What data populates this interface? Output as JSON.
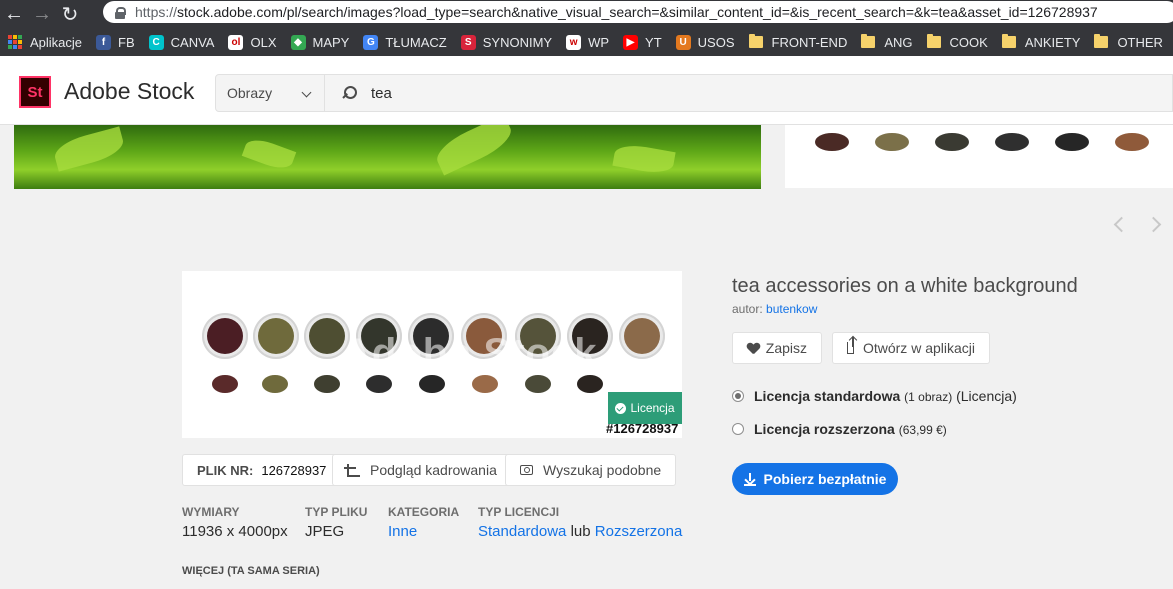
{
  "browser": {
    "url_scheme": "https://",
    "url_rest": "stock.adobe.com/pl/search/images?load_type=search&native_visual_search=&similar_content_id=&is_recent_search=&k=tea&asset_id=126728937",
    "bookmarks": [
      {
        "label": "Aplikacje",
        "icon": "apps-grid-icon"
      },
      {
        "label": "FB",
        "icon": "facebook-icon",
        "color": "#3b5998",
        "glyph": "f"
      },
      {
        "label": "CANVA",
        "icon": "canva-icon",
        "color": "#00c4cc",
        "glyph": "C"
      },
      {
        "label": "OLX",
        "icon": "olx-icon",
        "color": "#ffffff",
        "glyph": "ol"
      },
      {
        "label": "MAPY",
        "icon": "maps-icon",
        "color": "#34a853",
        "glyph": "◆"
      },
      {
        "label": "TŁUMACZ",
        "icon": "translate-icon",
        "color": "#4285f4",
        "glyph": "G"
      },
      {
        "label": "SYNONIMY",
        "icon": "synonimy-icon",
        "color": "#d9243b",
        "glyph": "S"
      },
      {
        "label": "WP",
        "icon": "wp-icon",
        "color": "#ffffff",
        "glyph": "w"
      },
      {
        "label": "YT",
        "icon": "youtube-icon",
        "color": "#ff0000",
        "glyph": "▶"
      },
      {
        "label": "USOS",
        "icon": "usos-icon",
        "color": "#e4791f",
        "glyph": "U"
      },
      {
        "label": "FRONT-END",
        "icon": "folder-icon"
      },
      {
        "label": "ANG",
        "icon": "folder-icon"
      },
      {
        "label": "COOK",
        "icon": "folder-icon"
      },
      {
        "label": "ANKIETY",
        "icon": "folder-icon"
      },
      {
        "label": "OTHER",
        "icon": "folder-icon"
      }
    ]
  },
  "header": {
    "logo": "St",
    "brand": "Adobe Stock",
    "filter_value": "Obrazy",
    "search_value": "tea"
  },
  "asset": {
    "watermark": "Adobe Stock",
    "license_badge": "Licencja",
    "id_label": "#126728937",
    "file_nr_label": "PLIK NR:",
    "file_nr": "126728937",
    "crop_preview": "Podgląd kadrowania",
    "find_similar": "Wyszukaj podobne",
    "meta": {
      "dimensions_label": "WYMIARY",
      "dimensions": "11936 x 4000px",
      "filetype_label": "TYP PLIKU",
      "filetype": "JPEG",
      "category_label": "KATEGORIA",
      "category": "Inne",
      "license_type_label": "TYP LICENCJI",
      "license_standard": "Standardowa",
      "license_or": "lub",
      "license_extended": "Rozszerzona"
    },
    "more_label": "WIĘCEJ (TA SAMA SERIA)"
  },
  "details": {
    "title": "tea accessories on a white background",
    "author_prefix": "autor:",
    "author": "butenkow",
    "save": "Zapisz",
    "open_in_app": "Otwórz w aplikacji",
    "license_standard_name": "Licencja standardowa",
    "license_standard_note": "(1 obraz)",
    "license_standard_suffix": "(Licencja)",
    "license_extended_name": "Licencja rozszerzona",
    "license_extended_price": "(63,99 €)",
    "download": "Pobierz bezpłatnie"
  },
  "colors": {
    "accent": "#1473e6",
    "license_badge": "#2d9d78",
    "brand_logo": "#ff3366"
  }
}
